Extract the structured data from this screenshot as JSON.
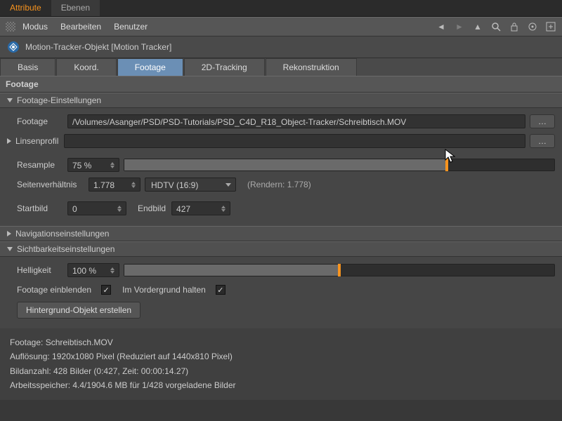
{
  "top_tabs": {
    "attribute": "Attribute",
    "ebenen": "Ebenen"
  },
  "menubar": {
    "modus": "Modus",
    "bearbeiten": "Bearbeiten",
    "benutzer": "Benutzer"
  },
  "object": {
    "title": "Motion-Tracker-Objekt [Motion Tracker]"
  },
  "tabs": {
    "basis": "Basis",
    "koord": "Koord.",
    "footage": "Footage",
    "tracking2d": "2D-Tracking",
    "rekonstruktion": "Rekonstruktion"
  },
  "section": {
    "footage": "Footage"
  },
  "groups": {
    "footage_settings": "Footage-Einstellungen",
    "lens": "Linsenprofil",
    "nav": "Navigationseinstellungen",
    "vis": "Sichtbarkeitseinstellungen"
  },
  "fields": {
    "footage_label": "Footage",
    "footage_path": "/Volumes/Asanger/PSD/PSD-Tutorials/PSD_C4D_R18_Object-Tracker/Schreibtisch.MOV",
    "resample_label": "Resample",
    "resample_value": "75 %",
    "aspect_label": "Seitenverhältnis",
    "aspect_value": "1.778",
    "aspect_preset": "HDTV (16:9)",
    "render_label": "(Rendern: 1.778)",
    "start_label": "Startbild",
    "start_value": "0",
    "end_label": "Endbild",
    "end_value": "427",
    "brightness_label": "Helligkeit",
    "brightness_value": "100 %",
    "show_footage_label": "Footage einblenden",
    "foreground_label": "Im Vordergrund halten",
    "create_bg_btn": "Hintergrund-Objekt erstellen"
  },
  "sliders": {
    "resample_fill_pct": 75,
    "brightness_fill_pct": 50
  },
  "info": {
    "line1": "Footage: Schreibtisch.MOV",
    "line2": "Auflösung: 1920x1080 Pixel (Reduziert auf 1440x810 Pixel)",
    "line3": "Bildanzahl: 428 Bilder (0:427, Zeit: 00:00:14.27)",
    "line4": "Arbeitsspeicher: 4.4/1904.6 MB für 1/428 vorgeladene Bilder"
  }
}
